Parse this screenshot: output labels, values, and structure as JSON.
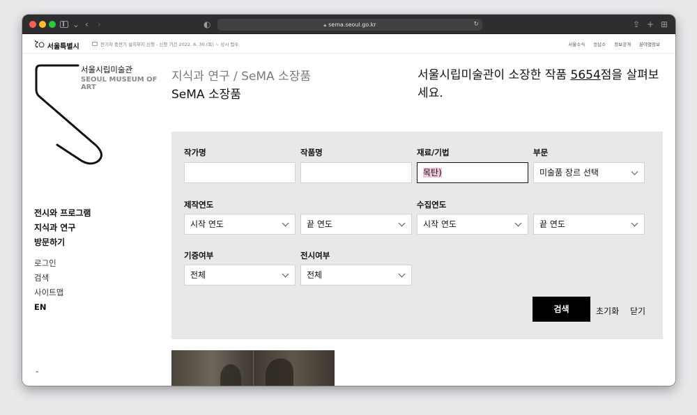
{
  "browser": {
    "url": "sema.seoul.go.kr"
  },
  "topbar": {
    "brand": "서울특별시",
    "notice": "전기차 충전기 설치부지 신청 - 신청 기간 2022. 6. 30.(목) ~ 상시 접수",
    "links": [
      "서울소식",
      "응답소",
      "정보공개",
      "분야별정보"
    ]
  },
  "logo": {
    "ko": "서울시립미술관",
    "en": "SEOUL MUSEUM OF ART"
  },
  "nav": {
    "main": [
      "전시와 프로그램",
      "지식과 연구",
      "방문하기"
    ],
    "sub": [
      "로그인",
      "검색",
      "사이트맵"
    ],
    "lang": "EN"
  },
  "header": {
    "breadcrumb": "지식과 연구 / SeMA 소장품",
    "title": "SeMA 소장품",
    "headline_prefix": "서울시립미술관이 소장한 작품 ",
    "headline_count": "5654",
    "headline_suffix": "점을 살펴보세요."
  },
  "search": {
    "artist_label": "작가명",
    "artist_value": "",
    "work_label": "작품명",
    "work_value": "",
    "material_label": "재료/기법",
    "material_value": "목탄)",
    "category_label": "부문",
    "category_value": "미술품 장르 선택",
    "production_label": "제작연도",
    "production_start": "시작 연도",
    "production_end": "끝 연도",
    "acquisition_label": "수집연도",
    "acquisition_start": "시작 연도",
    "acquisition_end": "끝 연도",
    "donation_label": "기증여부",
    "donation_value": "전체",
    "exhibit_label": "전시여부",
    "exhibit_value": "전체",
    "submit_label": "검색",
    "reset_label": "초기화",
    "close_label": "닫기"
  }
}
